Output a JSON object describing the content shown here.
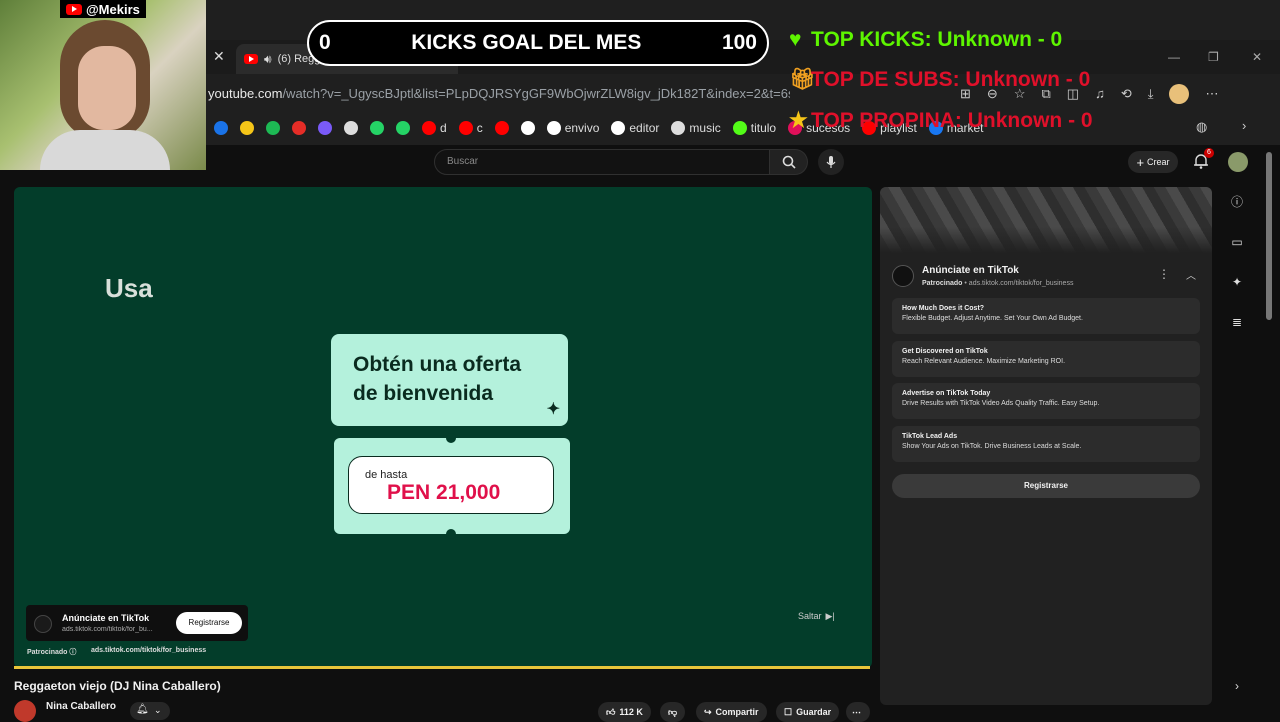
{
  "browser": {
    "tab_title": "(6) Reggaeton viejo (DJ Nina Ca",
    "url_host": "youtube.com",
    "url_path": "/watch?v=_UgyscBJptl&list=PLpDQJRSYgGF9WbOjwrZLW8igv_jDk182T&index=2&t=6s",
    "bookmarks": [
      {
        "label": "",
        "icon": "badge-26-icon",
        "color": "#1a73e8"
      },
      {
        "label": "",
        "icon": "bulb-icon",
        "color": "#f5c518"
      },
      {
        "label": "",
        "icon": "spotify-icon",
        "color": "#1db954"
      },
      {
        "label": "",
        "icon": "music-red-icon",
        "color": "#e52d27"
      },
      {
        "label": "",
        "icon": "app-icon",
        "color": "#7a5af8"
      },
      {
        "label": "",
        "icon": "openai-icon",
        "color": "#dddddd"
      },
      {
        "label": "",
        "icon": "whatsapp-icon",
        "color": "#25d366"
      },
      {
        "label": "",
        "icon": "green-app-icon",
        "color": "#25d366"
      },
      {
        "label": "d",
        "icon": "youtube-icon",
        "color": "#ff0000"
      },
      {
        "label": "c",
        "icon": "youtube-icon",
        "color": "#ff0000"
      },
      {
        "label": "",
        "icon": "youtube-icon",
        "color": "#ff0000"
      },
      {
        "label": "",
        "icon": "tiktok-icon",
        "color": "#ffffff"
      },
      {
        "label": "envivo",
        "icon": "tiktok-icon",
        "color": "#ffffff"
      },
      {
        "label": "editor",
        "icon": "tiktok-icon",
        "color": "#ffffff"
      },
      {
        "label": "music",
        "icon": "diamond-icon",
        "color": "#dddddd"
      },
      {
        "label": "titulo",
        "icon": "kick-icon",
        "color": "#53fc18"
      },
      {
        "label": "sucesos",
        "icon": "pink-icon",
        "color": "#e0105a"
      },
      {
        "label": "playlist",
        "icon": "youtube-icon",
        "color": "#ff0000"
      },
      {
        "label": "market",
        "icon": "meta-icon",
        "color": "#1877f2"
      }
    ]
  },
  "youtube": {
    "search_placeholder": "Buscar",
    "create_label": "Crear",
    "notifications_count": "6",
    "video_title": "Reggaeton viejo (DJ Nina Caballero)",
    "channel_name": "Nina Caballero",
    "likes": "112 K",
    "share_label": "Compartir",
    "save_label": "Guardar"
  },
  "video_ad": {
    "usa_text": "Usa",
    "offer_line1": "Obtén una oferta",
    "offer_line2": "de bienvenida",
    "price_prefix": "de hasta",
    "price": "PEN 21,000",
    "card_title": "Anúnciate en TikTok",
    "card_url": "ads.tiktok.com/tiktok/for_bu...",
    "card_button": "Registrarse",
    "sponsored": "Patrocinado",
    "sponsored_url": "ads.tiktok.com/tiktok/for_business",
    "skip": "Saltar",
    "progress": 1.0
  },
  "side_ad": {
    "title": "Anúnciate en TikTok",
    "sponsored": "Patrocinado",
    "url": "ads.tiktok.com/tiktok/for_business",
    "items": [
      {
        "title": "How Much Does it Cost?",
        "desc": "Flexible Budget. Adjust Anytime. Set Your Own Ad Budget."
      },
      {
        "title": "Get Discovered on TikTok",
        "desc": "Reach Relevant Audience. Maximize Marketing ROI."
      },
      {
        "title": "Advertise on TikTok Today",
        "desc": "Drive Results with TikTok Video Ads Quality Traffic. Easy Setup."
      },
      {
        "title": "TikTok Lead Ads",
        "desc": "Show Your Ads on TikTok. Drive Business Leads at Scale."
      }
    ],
    "register": "Registrarse"
  },
  "overlay": {
    "handle": "@Mekirs",
    "goal_current": "0",
    "goal_title": "KICKS GOAL DEL MES",
    "goal_target": "100",
    "top_kicks": "TOP KICKS: Unknown - 0",
    "top_subs": "TOP DE SUBS: Unknown - 0",
    "top_tips": "TOP PROPINA: Unknown - 0",
    "colors": {
      "kicks": "#5ef500",
      "subs": "#e0102a",
      "tips": "#e0102a"
    }
  }
}
